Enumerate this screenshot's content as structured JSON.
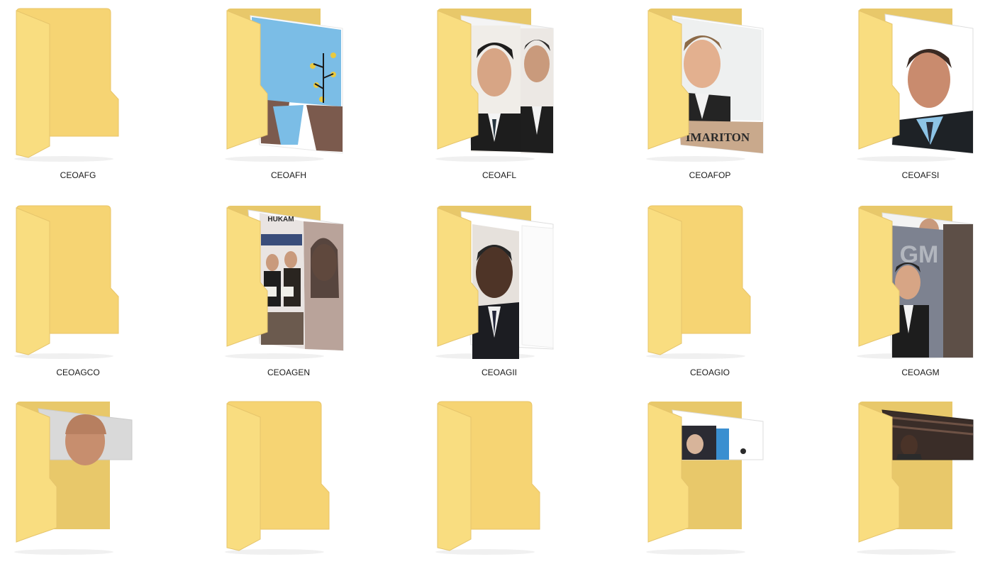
{
  "window": {
    "view": "Large icons",
    "colors": {
      "background": "#ffffff",
      "folder_back": "#e8c86a",
      "folder_front": "#f9dd80",
      "folder_front_shade": "#f6d473",
      "label_text": "#1a1a1a"
    }
  },
  "folders": [
    {
      "name": "CEOAFG",
      "preview": "empty"
    },
    {
      "name": "CEOAFH",
      "preview": "illustration"
    },
    {
      "name": "CEOAFL",
      "preview": "two-portraits"
    },
    {
      "name": "CEOAFOP",
      "preview": "portrait-banner"
    },
    {
      "name": "CEOAFSI",
      "preview": "portrait"
    },
    {
      "name": "CEOAGCO",
      "preview": "empty"
    },
    {
      "name": "CEOAGEN",
      "preview": "event-photo"
    },
    {
      "name": "CEOAGII",
      "preview": "portrait-doc"
    },
    {
      "name": "CEOAGIO",
      "preview": "empty"
    },
    {
      "name": "CEOAGM",
      "preview": "portrait-dark"
    },
    {
      "name": "",
      "preview": "portrait-bald"
    },
    {
      "name": "",
      "preview": "empty"
    },
    {
      "name": "",
      "preview": "empty"
    },
    {
      "name": "",
      "preview": "photo-dark"
    },
    {
      "name": "",
      "preview": "photo-stage"
    }
  ],
  "banner_texts": {
    "CEOAFOP": "IMARITON",
    "CEOAGEN": "HUKAM"
  }
}
